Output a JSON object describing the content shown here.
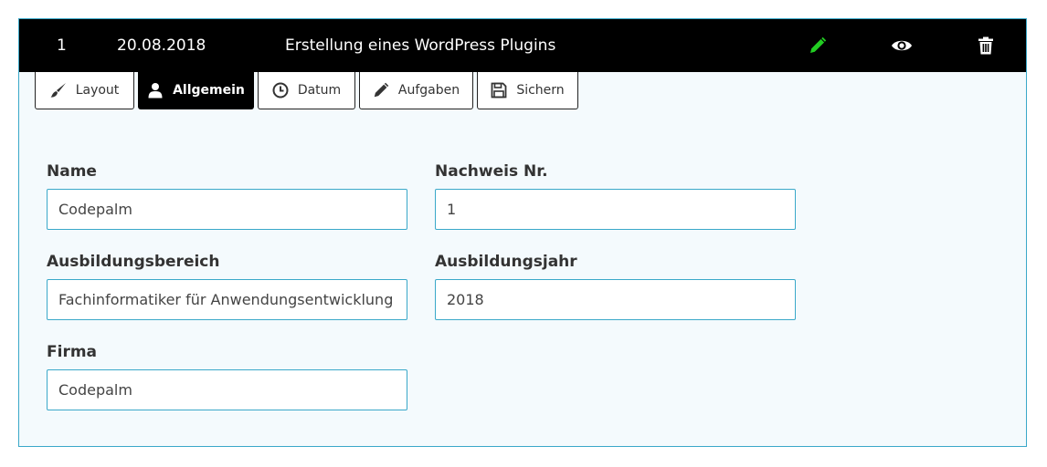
{
  "header": {
    "number": "1",
    "date": "20.08.2018",
    "title": "Erstellung eines WordPress Plugins",
    "icons": {
      "edit": "pencil-icon",
      "view": "eye-icon",
      "delete": "trash-icon"
    },
    "colors": {
      "background": "#000000",
      "edit_icon": "#22cc22",
      "icon": "#ffffff"
    }
  },
  "tabs": [
    {
      "label": "Layout",
      "icon": "brush-icon",
      "active": false
    },
    {
      "label": "Allgemein",
      "icon": "user-icon",
      "active": true
    },
    {
      "label": "Datum",
      "icon": "clock-icon",
      "active": false
    },
    {
      "label": "Aufgaben",
      "icon": "pencil-icon",
      "active": false
    },
    {
      "label": "Sichern",
      "icon": "floppy-disk-icon",
      "active": false
    }
  ],
  "form": {
    "name": {
      "label": "Name",
      "value": "Codepalm"
    },
    "nachweis": {
      "label": "Nachweis Nr.",
      "value": "1"
    },
    "ausbildungsbereich": {
      "label": "Ausbildungsbereich",
      "value": "Fachinformatiker für Anwendungsentwicklung"
    },
    "ausbildungsjahr": {
      "label": "Ausbildungsjahr",
      "value": "2018"
    },
    "firma": {
      "label": "Firma",
      "value": "Codepalm"
    }
  },
  "colors": {
    "accent_border": "#3aa8c9",
    "panel_background": "#f4fafd"
  }
}
